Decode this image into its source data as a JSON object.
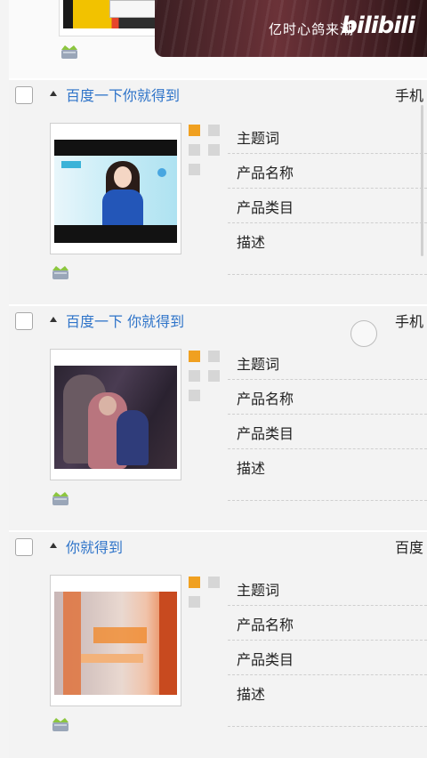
{
  "video_overlay": {
    "caption": "亿时心鸽来潮",
    "brand": "bilibili"
  },
  "records": [
    {
      "title": "百度一下你就得到",
      "right_tag": "手机",
      "thumb_scene": "woman-ad",
      "fields": [
        "主题词",
        "产品名称",
        "产品类目",
        "描述"
      ]
    },
    {
      "title": "百度一下 你就得到",
      "right_tag": "手机",
      "thumb_scene": "family-scene",
      "fields": [
        "主题词",
        "产品名称",
        "产品类目",
        "描述"
      ]
    },
    {
      "title": "你就得到",
      "right_tag": "百度",
      "thumb_scene": "orange-blur",
      "fields": [
        "主题词",
        "产品名称",
        "产品类目",
        "描述"
      ]
    }
  ],
  "colors": {
    "accent": "#f0a020",
    "link": "#2f74c9",
    "card_bg": "#f3f3f3"
  },
  "icons": [
    "crown-basket-icon",
    "checkbox-icon",
    "caret-up-icon",
    "loading-circle-icon"
  ]
}
